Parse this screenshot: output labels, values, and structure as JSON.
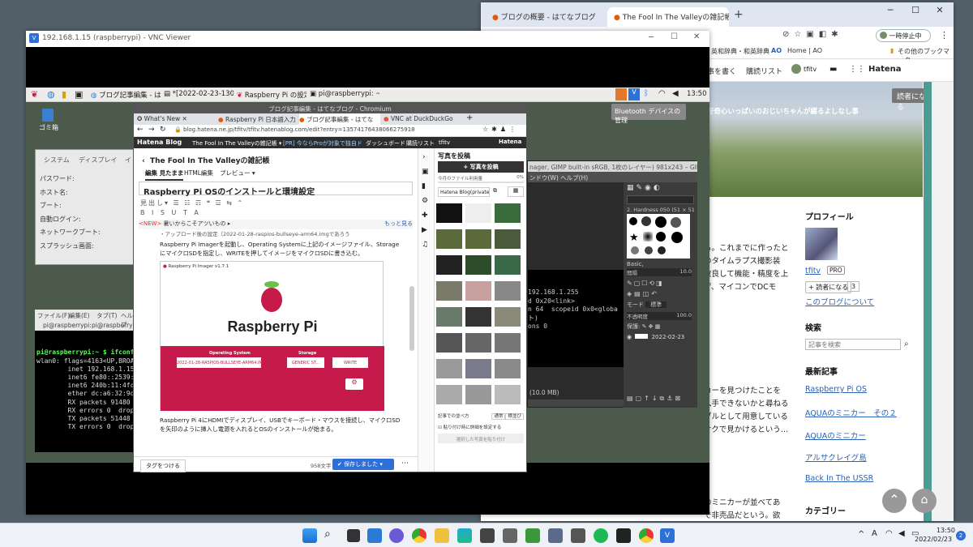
{
  "chrome": {
    "tabs": [
      {
        "label": "ブログの概要 - はてなブログ",
        "active": false
      },
      {
        "label": "The Fool In The Valleyの雑記帳",
        "active": true
      }
    ],
    "new_tab": "+",
    "min": "─",
    "max": "☐",
    "close": "✕",
    "address_text": "",
    "pause_label": "一時停止中",
    "bookmarks": [
      "英和辞典・和英辞典",
      "Home | AO",
      "その他のブックマーク"
    ],
    "hatena_actions": [
      "記事を書く",
      "購読リスト",
      "tfitv",
      "Hatena"
    ],
    "reader_button": "読者になる",
    "banner_caption": "好奇心いっぱいのおじいちゃんが綴るよしなし事",
    "body_snips": [
      "る。これまでに作ったと",
      "のタイムラプス撮影装",
      "改良して機能・精度を上",
      "げ、マイコンでDCモ",
      "カーを見つけたことを",
      "入手できないかと尋ねる",
      "ブルとして用意している",
      "オクで見かけるという…",
      "のミニカーが並べてあ",
      "で非売品だという。欲"
    ],
    "profile_heading": "プロフィール",
    "profile_name": "tfitv",
    "profile_badge": "PRO",
    "reader_small": "読者になる",
    "reader_count": "3",
    "about_link": "このブログについて",
    "search_heading": "検索",
    "search_placeholder": "記事を検索",
    "recent_heading": "最新記事",
    "recent_posts": [
      "Raspberry Pi OS",
      "AQUAのミニカー　その２",
      "AQUAのミニカー",
      "アルサクレイグ島",
      "Back In The USSR"
    ],
    "category_heading": "カテゴリー"
  },
  "vnc": {
    "title": "192.168.1.15 (raspberrypi) - VNC Viewer",
    "taskbar_items": [
      "ブログ記事編集 - は...",
      "*[2022-02-23-13004...",
      "Raspberry Pi の設定",
      "pi@raspberrypi: ~"
    ],
    "clock": "13:50",
    "bt_tooltip": "Bluetooth デバイスの管理",
    "trash_label": "ゴミ箱",
    "settings_tabs": [
      "システム",
      "ディスプレイ",
      "イ"
    ],
    "settings_rows": [
      "パスワード:",
      "ホスト名:",
      "ブート:",
      "自動ログイン:",
      "ネットワークブート:",
      "スプラッシュ画面:"
    ],
    "term_menu": [
      "ファイル(F)",
      "編集(E)",
      "タブ(T)",
      "ヘルプ"
    ],
    "term_tabs": [
      "pi@raspberrypi:",
      "pi@raspberrypi:"
    ],
    "term_lines": [
      "pi@raspberrypi:~ $ ifconf",
      "wlan0: flags=4163<UP,BROA",
      "        inet 192.168.1.15",
      "        inet6 fe80::2539:",
      "        inet6 240b:11:4fc",
      "        ether dc:a6:32:9d",
      "        RX packets 91480",
      "        RX errors 0  drop",
      "        TX packets 51448",
      "        TX errors 0  drop"
    ],
    "gimp_title": "nager, GIMP built-in sRGB, 1枚のレイヤー) 981x243 – GIMP",
    "gimp_menu": "ンドウ(W)   ヘルプ(H)",
    "gimp_term": [
      "192.168.1.255",
      "d 0x20<link>",
      "n 64  scopeid 0x0<globa",
      "ト)",
      "",
      "",
      "ons 0"
    ],
    "gimp_status": "(10.0 MB)",
    "gimp_brush": "2. Hardness 050 (51 × 51)",
    "gimp_basic": "Basic,",
    "gimp_spacing_label": "間隔",
    "gimp_spacing": "10.0",
    "gimp_mode_label": "モード",
    "gimp_mode": "標準",
    "gimp_opacity_label": "不透明度",
    "gimp_opacity": "100.0",
    "gimp_lock_label": "保護:",
    "gimp_layer": "2022-02-23"
  },
  "chromium": {
    "title": "ブログ記事編集 - はてなブログ - Chromium",
    "tabs": [
      "What's New",
      "Raspberry Pi 日本語入力",
      "ブログ記事編集 - はてな",
      "VNC at DuckDuckGo"
    ],
    "url": "blog.hatena.ne.jp/tfitv/tfitv.hatenablog.com/edit?entry=13574176438066275918",
    "hatena_logo": "Hatena Blog",
    "blog_name": "The Fool In The Valleyの雑記帳 ▾",
    "promo": "[PR] 今ならProが対象で独自ドメイン無料",
    "nav_items": [
      "ダッシュボード",
      "購読リスト",
      "tfitv",
      "Hatena"
    ],
    "edit_blog_title": "The Fool In The Valleyの雑記帳",
    "mode_tabs": [
      "編集 見たまま",
      "HTML編集",
      "プレビュー ▾"
    ],
    "post_title": "Raspberry Pi OSのインストールと環境設定",
    "new_notice_badge": "<NEW>",
    "new_notice": "暑いからこそアツいもの ▸",
    "more_link": "もっと見る",
    "body_top_cut": "・アップロード後の設定（2022-01-28-raspios-bullseye-arm64.imgであろう",
    "body_para1": "Raspberry Pi Imagerを起動し、Operating Systemに上記のイメージファイル、Storage にマイクロSDを指定し、WRITEを押してイメージをマイクロSDに書き込む。",
    "imager_title": "Raspberry Pi Imager v1.7.1",
    "imager_logo": "Raspberry Pi",
    "imager_os_label": "Operating System",
    "imager_os_value": "2022-01-28-RASPIOS-BULLSEYE-ARM64.IMG",
    "imager_storage_label": "Storage",
    "imager_storage_value": "GENERIC ST...",
    "imager_write": "WRITE",
    "body_para2": "Raspberry Pi 4にHDMIでディスプレイ、USBでキーボード・マウスを接続し、マイクロSDを矢印のように挿入し電源を入れるとOSのインストールが始まる。",
    "tag_button": "タグをつける",
    "char_count": "958文字",
    "save_button": "✔ 保存しました",
    "photo_panel_title": "写真を投稿",
    "photo_upload": "+ 写真を投稿",
    "photo_usage_label": "今月のファイル利用量",
    "photo_usage_value": "0%",
    "photo_album": "Hatena Blog(private) ▾",
    "photo_order_label": "記事での並べ方",
    "photo_order_options": [
      "通常",
      "横並び"
    ],
    "photo_option": "貼り付け時に詳細を設定する",
    "photo_paste": "選択した写真を貼り付け"
  },
  "taskbar": {
    "time": "13:50",
    "date": "2022/02/23",
    "notify": "2",
    "tray": [
      "^",
      "A"
    ]
  },
  "colors": {
    "accent_blue": "#2e6fd8",
    "raspberry": "#c51a4a",
    "teal": "#4c9c94"
  }
}
